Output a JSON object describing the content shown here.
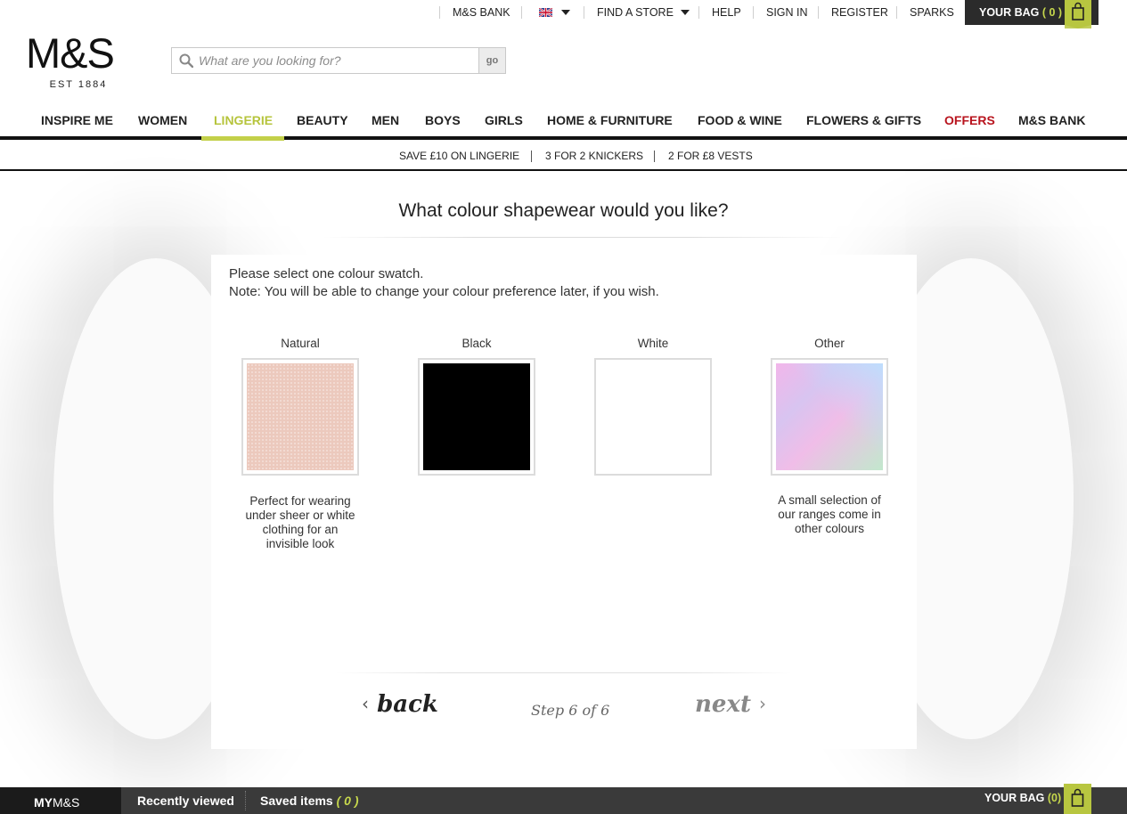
{
  "util": {
    "bank": "M&S BANK",
    "find_store": "FIND A STORE",
    "help": "HELP",
    "sign_in": "SIGN IN",
    "register": "REGISTER",
    "sparks": "SPARKS",
    "bag_label": "YOUR BAG",
    "bag_count": "( 0 )"
  },
  "logo": {
    "main": "M&S",
    "sub": "EST 1884"
  },
  "search": {
    "placeholder": "What are you looking for?",
    "value": "",
    "go_label": "go"
  },
  "nav": [
    "INSPIRE ME",
    "WOMEN",
    "LINGERIE",
    "BEAUTY",
    "MEN",
    "BOYS",
    "GIRLS",
    "HOME & FURNITURE",
    "FOOD & WINE",
    "FLOWERS & GIFTS",
    "OFFERS",
    "M&S BANK"
  ],
  "nav_active": "LINGERIE",
  "promos": [
    "SAVE £10 ON LINGERIE",
    "3 FOR 2 KNICKERS",
    "2 FOR £8 VESTS"
  ],
  "question": "What colour shapewear would you like?",
  "instruction": {
    "line1": "Please select one colour swatch.",
    "line2": "Note: You will be able to change your colour preference later, if you wish."
  },
  "swatches": [
    {
      "label": "Natural",
      "description": "Perfect for wearing under sheer or white clothing for an invisible look",
      "color": "#ecc9bd"
    },
    {
      "label": "Black",
      "description": "",
      "color": "#000000"
    },
    {
      "label": "White",
      "description": "",
      "color": "#ffffff"
    },
    {
      "label": "Other",
      "description": "A small selection of our ranges come in other colours",
      "color": "#e4c0ee"
    }
  ],
  "stepper": {
    "back": "back",
    "step": "Step 6 of 6",
    "next": "next"
  },
  "bottom": {
    "my_ms_prefix": "MY",
    "my_ms_brand": "M&S",
    "recently_viewed": "Recently viewed",
    "saved_items": "Saved items",
    "saved_count": "( 0 )",
    "bag_label": "YOUR BAG",
    "bag_count": "(0)"
  },
  "colors": {
    "accent": "#c3d04a",
    "offers": "#b8141e",
    "dark": "#2b2b2b"
  }
}
